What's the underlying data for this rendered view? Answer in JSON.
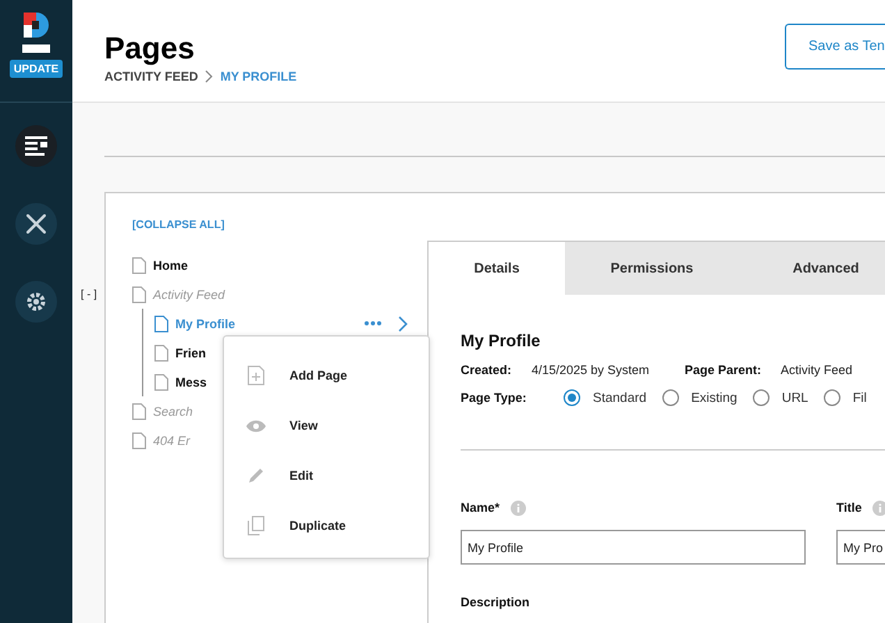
{
  "sidebar": {
    "update_badge": "UPDATE",
    "items": [
      {
        "kind": "pages",
        "selected": true
      },
      {
        "kind": "tools",
        "selected": false
      },
      {
        "kind": "settings",
        "selected": false
      }
    ]
  },
  "header": {
    "title": "Pages",
    "breadcrumb": [
      {
        "label": "ACTIVITY FEED",
        "current": false
      },
      {
        "label": "MY PROFILE",
        "current": true
      }
    ],
    "button": "Save as Ten"
  },
  "tree": {
    "collapse_all": "[COLLAPSE ALL]",
    "toggle": "[ - ]",
    "items": [
      {
        "label": "Home",
        "hidden": false,
        "selected": false
      },
      {
        "label": "Activity Feed",
        "hidden": true,
        "selected": false,
        "expanded": true,
        "children": [
          {
            "label": "My Profile",
            "hidden": false,
            "selected": true
          },
          {
            "label": "Frien",
            "hidden": false,
            "selected": false
          },
          {
            "label": "Mess",
            "hidden": false,
            "selected": false
          }
        ]
      },
      {
        "label": "Search",
        "hidden": true,
        "selected": false
      },
      {
        "label": "404 Er",
        "hidden": true,
        "selected": false
      }
    ]
  },
  "context_menu": [
    {
      "kind": "add",
      "label": "Add Page"
    },
    {
      "kind": "view",
      "label": "View"
    },
    {
      "kind": "edit",
      "label": "Edit"
    },
    {
      "kind": "duplicate",
      "label": "Duplicate"
    }
  ],
  "tabs": [
    {
      "label": "Details",
      "selected": true
    },
    {
      "label": "Permissions",
      "selected": false
    },
    {
      "label": "Advanced",
      "selected": false
    }
  ],
  "details": {
    "title": "My Profile",
    "created_label": "Created:",
    "created": "4/15/2025 by System",
    "parent_label": "Page Parent:",
    "parent": "Activity Feed",
    "type_label": "Page Type:",
    "page_types": [
      {
        "label": "Standard",
        "selected": true
      },
      {
        "label": "Existing",
        "selected": false
      },
      {
        "label": "URL",
        "selected": false
      },
      {
        "label": "Fil",
        "selected": false
      }
    ],
    "name_label": "Name*",
    "name_value": "My Profile",
    "title_label": "Title",
    "title_value": "My Pro",
    "description_label": "Description"
  }
}
